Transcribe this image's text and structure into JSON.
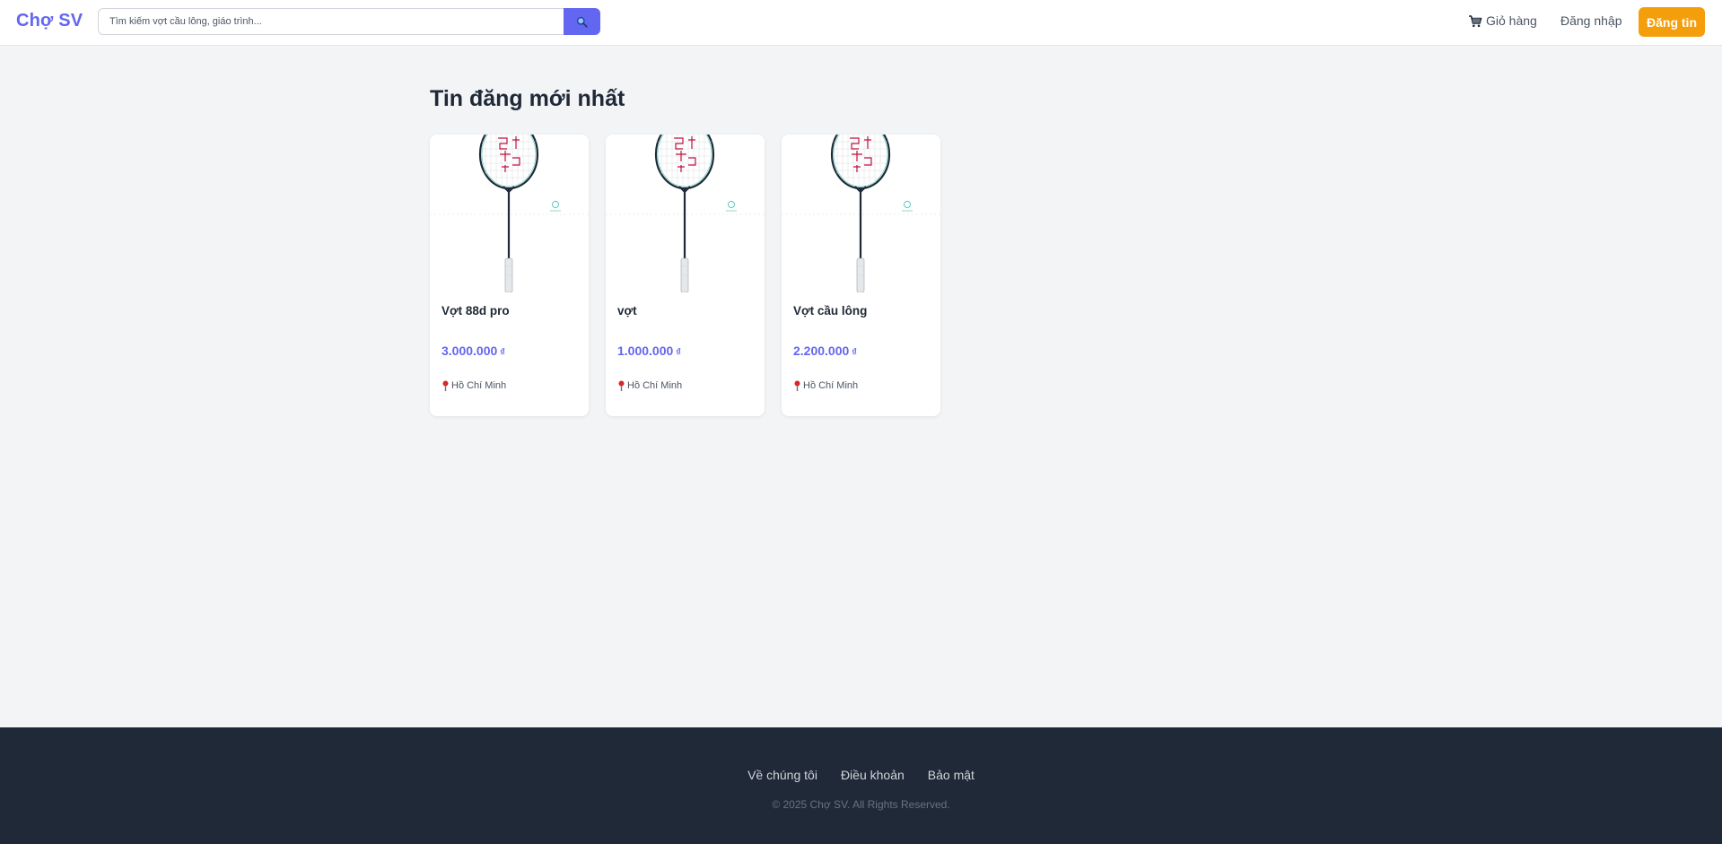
{
  "header": {
    "logo": "Chợ SV",
    "search": {
      "placeholder": "Tìm kiếm vợt cầu lông, giáo trình...",
      "value": ""
    },
    "search_icon": "magnifier-icon",
    "cart_icon": "cart-icon",
    "cart_label": "Giỏ hàng",
    "login_label": "Đăng nhập",
    "post_label": "Đăng tin"
  },
  "main": {
    "title": "Tin đăng mới nhất",
    "products": [
      {
        "title": "Vợt 88d pro",
        "price": "3.000.000",
        "currency": "₫",
        "location": "Hồ Chí Minh"
      },
      {
        "title": "vợt",
        "price": "1.000.000",
        "currency": "₫",
        "location": "Hồ Chí Minh"
      },
      {
        "title": "Vợt cầu lông",
        "price": "2.200.000",
        "currency": "₫",
        "location": "Hồ Chí Minh"
      }
    ]
  },
  "footer": {
    "links": [
      "Về chúng tôi",
      "Điều khoản",
      "Bảo mật"
    ],
    "copyright": "© 2025 Chợ SV. All Rights Reserved."
  },
  "colors": {
    "brand": "#6366f1",
    "accent": "#f59e0b",
    "footer_bg": "#1f2937",
    "page_bg": "#f3f4f6"
  }
}
